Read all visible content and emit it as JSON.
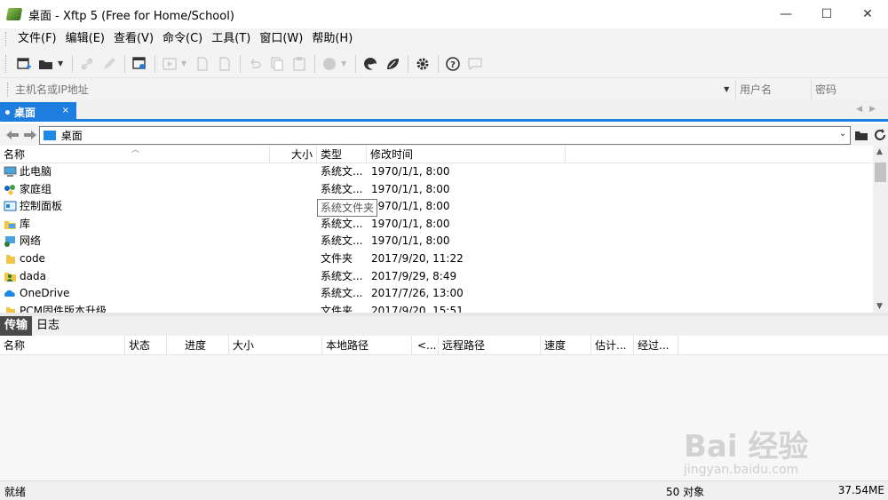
{
  "window": {
    "title": "桌面 - Xftp 5 (Free for Home/School)",
    "minimize": "—",
    "maximize": "☐",
    "close": "✕"
  },
  "menu": [
    "文件(F)",
    "编辑(E)",
    "查看(V)",
    "命令(C)",
    "工具(T)",
    "窗口(W)",
    "帮助(H)"
  ],
  "address": {
    "host_placeholder": "主机名或IP地址",
    "user_placeholder": "用户名",
    "pass_placeholder": "密码"
  },
  "tab": {
    "label": "桌面",
    "close": "×"
  },
  "path": {
    "value": "桌面"
  },
  "file_columns": {
    "name": "名称",
    "size": "大小",
    "type": "类型",
    "modified": "修改时间"
  },
  "files": [
    {
      "name": "此电脑",
      "size": "",
      "type": "系统文...",
      "modified": "1970/1/1, 8:00",
      "icon": "computer-icon"
    },
    {
      "name": "家庭组",
      "size": "",
      "type": "系统文...",
      "modified": "1970/1/1, 8:00",
      "icon": "homegroup-icon"
    },
    {
      "name": "控制面板",
      "size": "",
      "type": "系统文...",
      "modified": "1970/1/1, 8:00",
      "icon": "control-panel-icon"
    },
    {
      "name": "库",
      "size": "",
      "type": "系统文...",
      "modified": "1970/1/1, 8:00",
      "icon": "library-icon"
    },
    {
      "name": "网络",
      "size": "",
      "type": "系统文...",
      "modified": "1970/1/1, 8:00",
      "icon": "network-icon"
    },
    {
      "name": "code",
      "size": "",
      "type": "文件夹",
      "modified": "2017/9/20, 11:22",
      "icon": "folder-icon"
    },
    {
      "name": "dada",
      "size": "",
      "type": "系统文...",
      "modified": "2017/9/29, 8:49",
      "icon": "user-folder-icon"
    },
    {
      "name": "OneDrive",
      "size": "",
      "type": "系统文...",
      "modified": "2017/7/26, 13:00",
      "icon": "onedrive-icon"
    },
    {
      "name": "PCM固件版本升级",
      "size": "",
      "type": "文件夹",
      "modified": "2017/9/20, 15:51",
      "icon": "folder-icon"
    }
  ],
  "tooltip": "系统文件夹",
  "transfer_tabs": [
    "传输",
    "日志"
  ],
  "transfer_columns": [
    "名称",
    "状态",
    "进度",
    "大小",
    "本地路径",
    "<...",
    "远程路径",
    "速度",
    "估计...",
    "经过..."
  ],
  "status": {
    "ready": "就绪",
    "count": "50 对象",
    "size": "37.54ME"
  },
  "watermark": {
    "brand": "Bai 经验",
    "url": "jingyan.baidu.com"
  },
  "colors": {
    "accent": "#1e7ee0",
    "active_tab_dark": "#4a4a4a"
  }
}
